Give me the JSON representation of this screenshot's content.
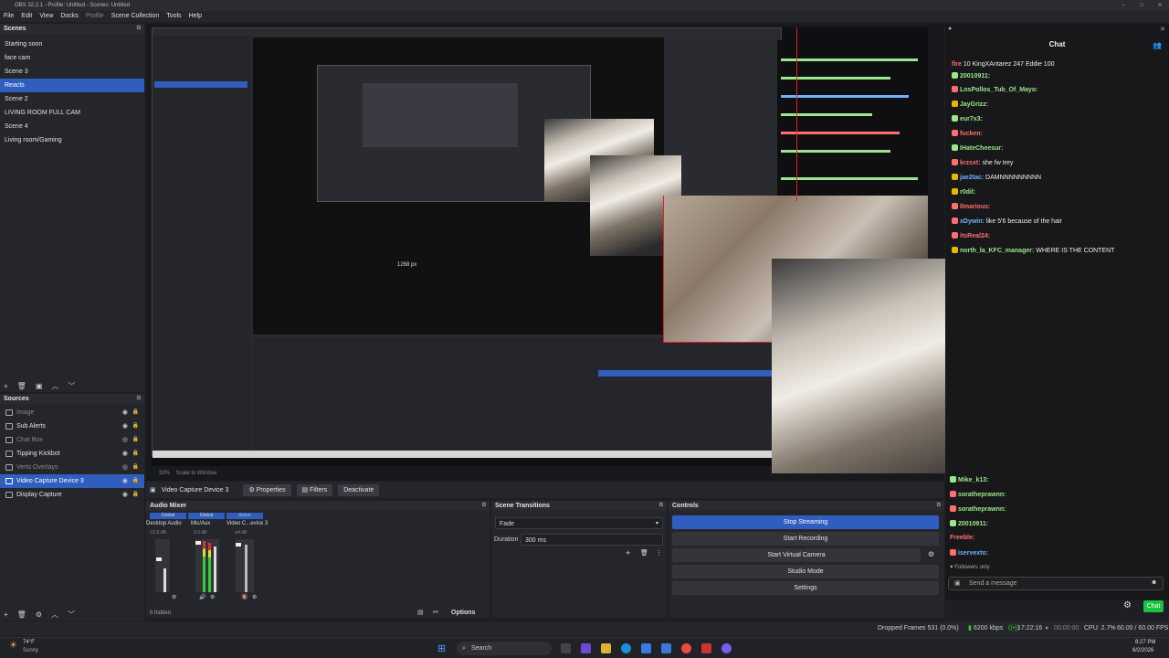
{
  "window": {
    "title": "OBS 32.2.1 - Profile: Untitled - Scenes: Untitled"
  },
  "menu": [
    "File",
    "Edit",
    "View",
    "Docks",
    "Profile",
    "Scene Collection",
    "Tools",
    "Help"
  ],
  "scenes": {
    "title": "Scenes",
    "items": [
      {
        "label": "Starting soon"
      },
      {
        "label": "face cam"
      },
      {
        "label": "Scene 3"
      },
      {
        "label": "Reacts",
        "selected": true
      },
      {
        "label": "Scene 2"
      },
      {
        "label": "LIVING ROOM FULL CAM"
      },
      {
        "label": "Scene 4"
      },
      {
        "label": "Living room/Gaming"
      }
    ]
  },
  "sources": {
    "title": "Sources",
    "items": [
      {
        "label": "Image",
        "dim": true
      },
      {
        "label": "Sub Alerts"
      },
      {
        "label": "Chat Box",
        "dim": true
      },
      {
        "label": "Tipping Kickbot"
      },
      {
        "label": "Verts Overlays",
        "dim": true
      },
      {
        "label": "Video Capture Device 3",
        "selected": true
      },
      {
        "label": "Display Capture"
      }
    ]
  },
  "preview": {
    "inner_label": "1268 px",
    "zoom": "33%",
    "scale": "Scale to Window"
  },
  "source_toolbar": {
    "selected": "Video Capture Device 3",
    "properties": "Properties",
    "filters": "Filters",
    "deactivate": "Deactivate"
  },
  "audio": {
    "title": "Audio Mixer",
    "channels": [
      {
        "label": "Desktop Audio",
        "scope": "Global",
        "db": "-12.5 dB"
      },
      {
        "label": "Mic/Aux",
        "scope": "Global",
        "db": "0.0 dB"
      },
      {
        "label": "Video C...evice 3",
        "scope": "Active",
        "db": "-inf dB"
      }
    ],
    "hidden": "0 hidden",
    "options": "Options"
  },
  "transitions": {
    "title": "Scene Transitions",
    "type": "Fade",
    "duration_label": "Duration",
    "duration": "300 ms"
  },
  "controls": {
    "title": "Controls",
    "buttons": [
      "Stop Streaming",
      "Start Recording",
      "Start Virtual Camera",
      "Studio Mode",
      "Settings"
    ]
  },
  "chat": {
    "title": "Chat",
    "lines": [
      {
        "user": "fire",
        "text": "10   KingXAntarez 247   Eddie 100"
      },
      {
        "user": "20010911:",
        "text": ""
      },
      {
        "user": "LosPollos_Tub_Of_Mayo:",
        "text": ""
      },
      {
        "user": "JayGrizz:",
        "text": ""
      },
      {
        "user": "eur7x3:",
        "text": ""
      },
      {
        "user": "fucken:",
        "text": ""
      },
      {
        "user": "IHateCheesur:",
        "text": ""
      },
      {
        "user": "krzsxt:",
        "text": "she fw trey"
      },
      {
        "user": "jae2tac:",
        "text": "DAMNNNNNNNNN"
      },
      {
        "user": "r0dil:",
        "text": ""
      },
      {
        "user": "Ilmarious:",
        "text": ""
      },
      {
        "user": "xDywin:",
        "text": "like 5'6 because of the hair"
      },
      {
        "user": "itsReal24:",
        "text": ""
      },
      {
        "user": "north_la_KFC_manager:",
        "text": "WHERE IS THE CONTENT"
      }
    ],
    "lower_lines": [
      {
        "user": "Mike_k13:",
        "text": ""
      },
      {
        "user": "soratheprawnn:",
        "text": ""
      },
      {
        "user": "soratheprawnn:",
        "text": ""
      },
      {
        "user": "20010911:",
        "text": ""
      },
      {
        "user": "Freeble:",
        "text": ""
      },
      {
        "user": "iservexto:",
        "text": ""
      }
    ],
    "followers": "Followers only",
    "placeholder": "Send a message",
    "send": "Chat"
  },
  "status": {
    "dropped": "Dropped Frames 531 (0.0%)",
    "kbps": "6200 kbps",
    "live_time": "17:22:16",
    "rec_time": "00:00:00",
    "cpu": "CPU: 2.7%",
    "fps": "60.00 / 60.00 FPS"
  },
  "taskbar": {
    "weather_temp": "74°F",
    "weather_desc": "Sunny",
    "search": "Search",
    "time": "8:27 PM",
    "date": "8/2/2026"
  }
}
